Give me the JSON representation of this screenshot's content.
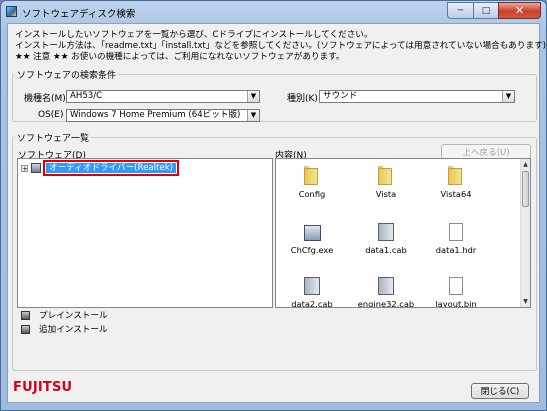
{
  "window": {
    "title": "ソフトウェアディスク検索",
    "controls": {
      "minimize": "─",
      "maximize": "□",
      "close": "✕"
    }
  },
  "intro": {
    "line1": "インストールしたいソフトウェアを一覧から選び、Cドライブにインストールしてください。",
    "line2": "インストール方法は、「readme.txt」「install.txt」などを参照してください。(ソフトウェアによっては用意されていない場合もあります)",
    "line3": "★★ 注意 ★★ お使いの機種によっては、ご利用になれないソフトウェアがあります。"
  },
  "search": {
    "legend": "ソフトウェアの検索条件",
    "model_label": "機種名(M)",
    "model_value": "AH53/C",
    "os_label": "OS(E)",
    "os_value": "Windows 7 Home Premium (64ビット版)",
    "kind_label": "種別(K)",
    "kind_value": "サウンド",
    "arrow": "▼"
  },
  "list": {
    "legend": "ソフトウェア一覧",
    "tree_label": "ソフトウェア(D)",
    "contents_label": "内容(N)",
    "up_button": "上へ戻る(U)",
    "tree_expander": "+",
    "selected_item": "オーディオドライバー(Realtek)",
    "files": [
      {
        "name": "Config",
        "type": "folder"
      },
      {
        "name": "Vista",
        "type": "folder"
      },
      {
        "name": "Vista64",
        "type": "folder"
      },
      {
        "name": "ChCfg.exe",
        "type": "exe"
      },
      {
        "name": "data1.cab",
        "type": "cab"
      },
      {
        "name": "data1.hdr",
        "type": "doc"
      },
      {
        "name": "data2.cab",
        "type": "cab"
      },
      {
        "name": "engine32.cab",
        "type": "cab"
      },
      {
        "name": "layout.bin",
        "type": "doc"
      }
    ],
    "scroll_up": "▲",
    "scroll_down": "▼"
  },
  "legend_keys": {
    "preinstall": "プレインストール",
    "addinstall": "追加インストール"
  },
  "footer": {
    "logo": "FUJITSU",
    "close_button": "閉じる(C)"
  }
}
